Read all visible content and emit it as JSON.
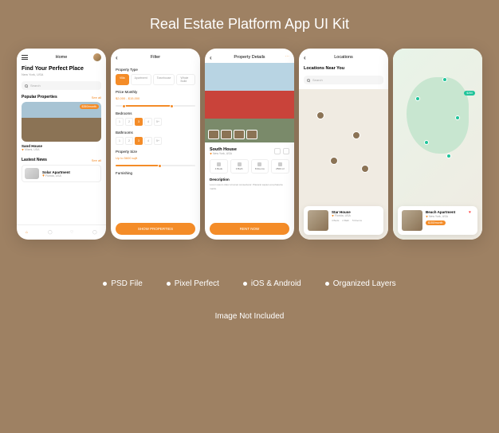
{
  "header": {
    "title": "Real Estate Platform App UI Kit"
  },
  "screens": {
    "home": {
      "title": "Home",
      "hero": "Find Your Perfect Place",
      "location": "New York, USA",
      "search_placeholder": "Search",
      "popular_label": "Popular Properties",
      "see_all": "See all",
      "card": {
        "name": "Sand House",
        "location": "Miami, USA",
        "price": "$350/month"
      },
      "news_label": "Lastest News",
      "news": {
        "name": "Solar Apartment",
        "location": "Florida, USA"
      }
    },
    "filter": {
      "title": "Filter",
      "type_label": "Property Type",
      "types": [
        "Villa",
        "Apartment",
        "Townhouse",
        "Whole Build"
      ],
      "price_label": "Price Monthly",
      "price_range": "$2,000 - $15,000",
      "bedrooms_label": "Bedrooms",
      "bathrooms_label": "Bathrooms",
      "nums": [
        "1",
        "2",
        "3",
        "4",
        "5+"
      ],
      "size_label": "Property Size",
      "size_value": "Up to 5600 sqft",
      "furnishing_label": "Furnishing",
      "button": "SHOW PROPERTIES"
    },
    "details": {
      "title": "Property Details",
      "name": "South House",
      "location": "New York, USA",
      "specs": [
        {
          "label": "4 Beds"
        },
        {
          "label": "3 Bath"
        },
        {
          "label": "8 Rooms"
        },
        {
          "label": "2500 m²"
        }
      ],
      "desc_label": "Description",
      "desc": "Lorem ipsum dolor sit amet consectetur. Placerat sapien est pharetra mattis.",
      "button": "RENT NOW"
    },
    "locations": {
      "title": "Locations",
      "heading": "Locations Near You",
      "search_placeholder": "Search",
      "card": {
        "name": "Star House",
        "location": "Florida, USA",
        "beds": "4 Beds",
        "bath": "2 Bath",
        "rooms": "5 Rooms"
      }
    },
    "map": {
      "price": "$250",
      "card": {
        "name": "Beach Apartment",
        "location": "New York, USA",
        "price": "$150/month"
      }
    }
  },
  "features": [
    "PSD File",
    "Pixel Perfect",
    "iOS & Android",
    "Organized Layers"
  ],
  "footer": "Image Not Included"
}
